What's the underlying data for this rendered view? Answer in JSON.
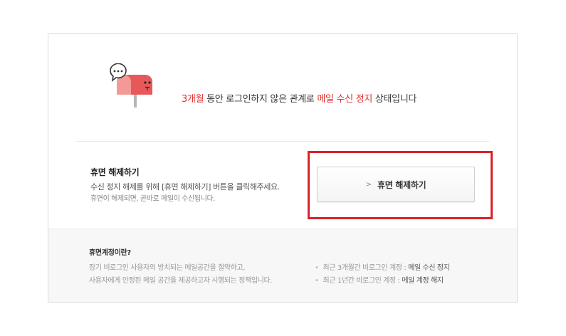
{
  "notice": {
    "icon": "mailbox-sleeping-icon",
    "period_highlight": "3개월",
    "text_middle": " 동안 로그인하지 않은 관계로 ",
    "status_highlight": "메일 수신 정지",
    "text_end": " 상태입니다"
  },
  "release": {
    "title": "휴면 해제하기",
    "description_line1": "수신 정지 해제를 위해 [휴면 해제하기] 버튼을 클릭해주세요.",
    "description_line2": "휴면이 해제되면, 곧바로 메일이 수신됩니다.",
    "button_chevron": ">",
    "button_label": "휴면 해제하기"
  },
  "info": {
    "title": "휴면계정이란?",
    "line1": "장기 비로그인 사용자의 방치되는 메일공간을 절약하고,",
    "line2": "사용자에게 안정된 메일 공간을 제공하고자 시행되는 정책입니다.",
    "bullets": [
      {
        "prefix": "최근 3개월간 비로그인 계정 : ",
        "value": "메일 수신 정지"
      },
      {
        "prefix": "최근 1년간 비로그인 계정 : ",
        "value": "메일 계정 해지"
      }
    ]
  },
  "colors": {
    "highlight": "#e0302f",
    "annotation_box": "#d9222a",
    "mailbox_red": "#e8585a"
  }
}
